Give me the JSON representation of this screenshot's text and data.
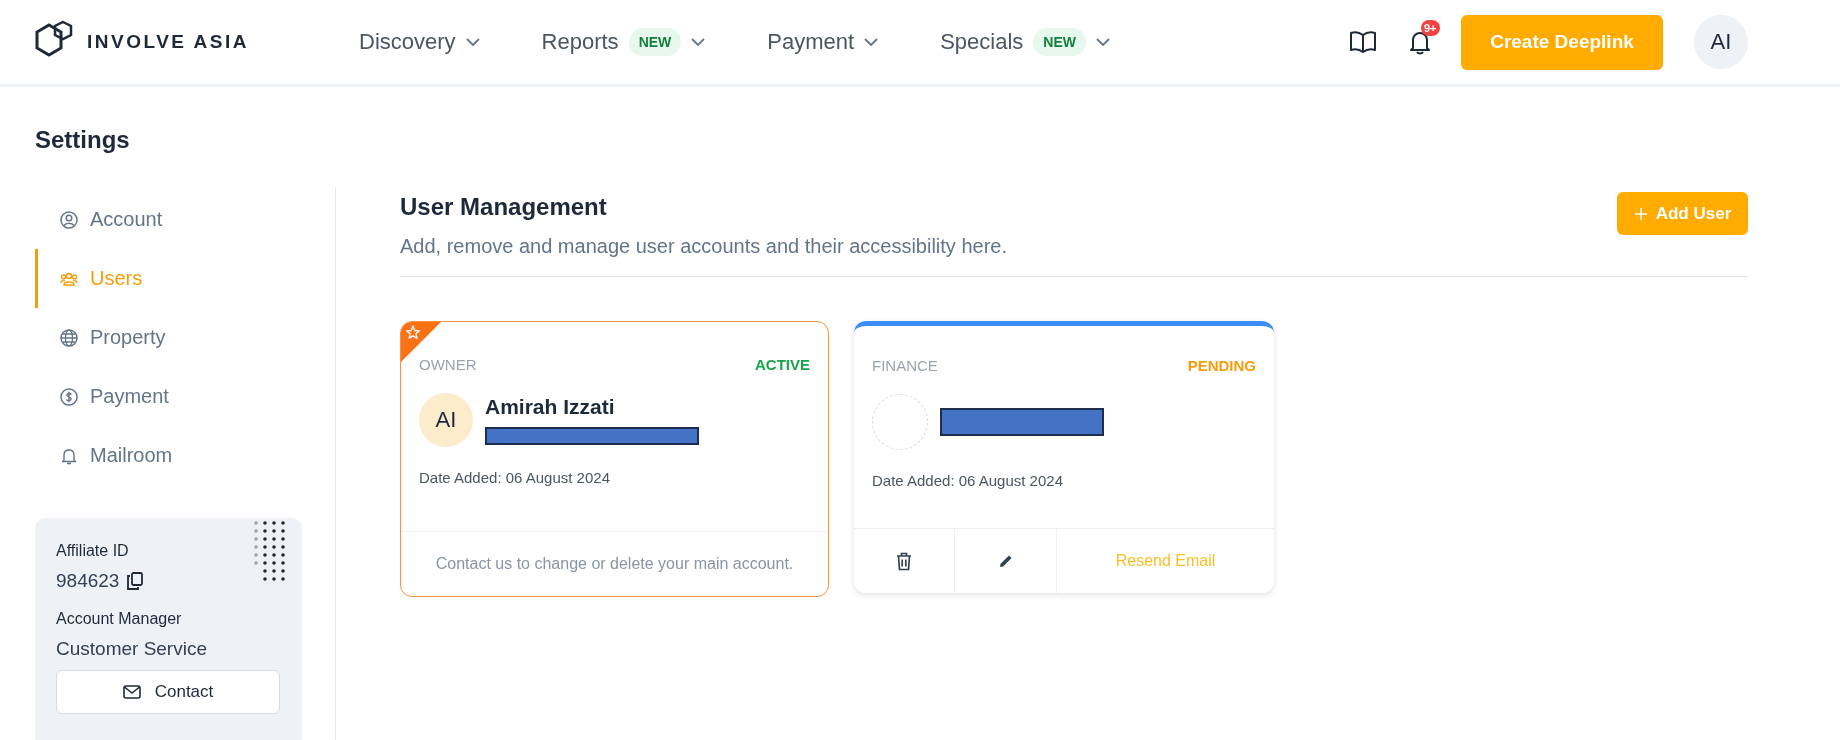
{
  "header": {
    "logo_text": "INVOLVE ASIA",
    "nav": [
      {
        "label": "Discovery"
      },
      {
        "label": "Reports",
        "badge": "NEW"
      },
      {
        "label": "Payment"
      },
      {
        "label": "Specials",
        "badge": "NEW"
      }
    ],
    "notification_count": "9+",
    "create_button": "Create Deeplink",
    "avatar": "AI"
  },
  "sidebar": {
    "title": "Settings",
    "items": [
      {
        "label": "Account",
        "kind": "user",
        "selected": false
      },
      {
        "label": "Users",
        "kind": "users",
        "selected": true
      },
      {
        "label": "Property",
        "kind": "globe",
        "selected": false
      },
      {
        "label": "Payment",
        "kind": "dollar",
        "selected": false
      },
      {
        "label": "Mailroom",
        "kind": "bell",
        "selected": false
      }
    ],
    "info": {
      "affiliate_id_label": "Affiliate ID",
      "affiliate_id": "984623",
      "manager_label": "Account Manager",
      "manager": "Customer Service",
      "contact_button": "Contact"
    }
  },
  "main": {
    "title": "User Management",
    "subtitle": "Add, remove and manage user accounts and their accessibility here.",
    "add_button": "Add User",
    "users": [
      {
        "kind": "owner",
        "role": "OWNER",
        "status": "ACTIVE",
        "color": "#16a34a",
        "initials": "AI",
        "name": "Amirah Izzati",
        "date": "Date Added: 06 August 2024",
        "note": "Contact us to change or delete your main account."
      },
      {
        "kind": "member",
        "role": "FINANCE",
        "status": "PENDING",
        "color": "#f59e0b",
        "date": "Date Added: 06 August 2024",
        "resend": "Resend Email"
      }
    ]
  }
}
